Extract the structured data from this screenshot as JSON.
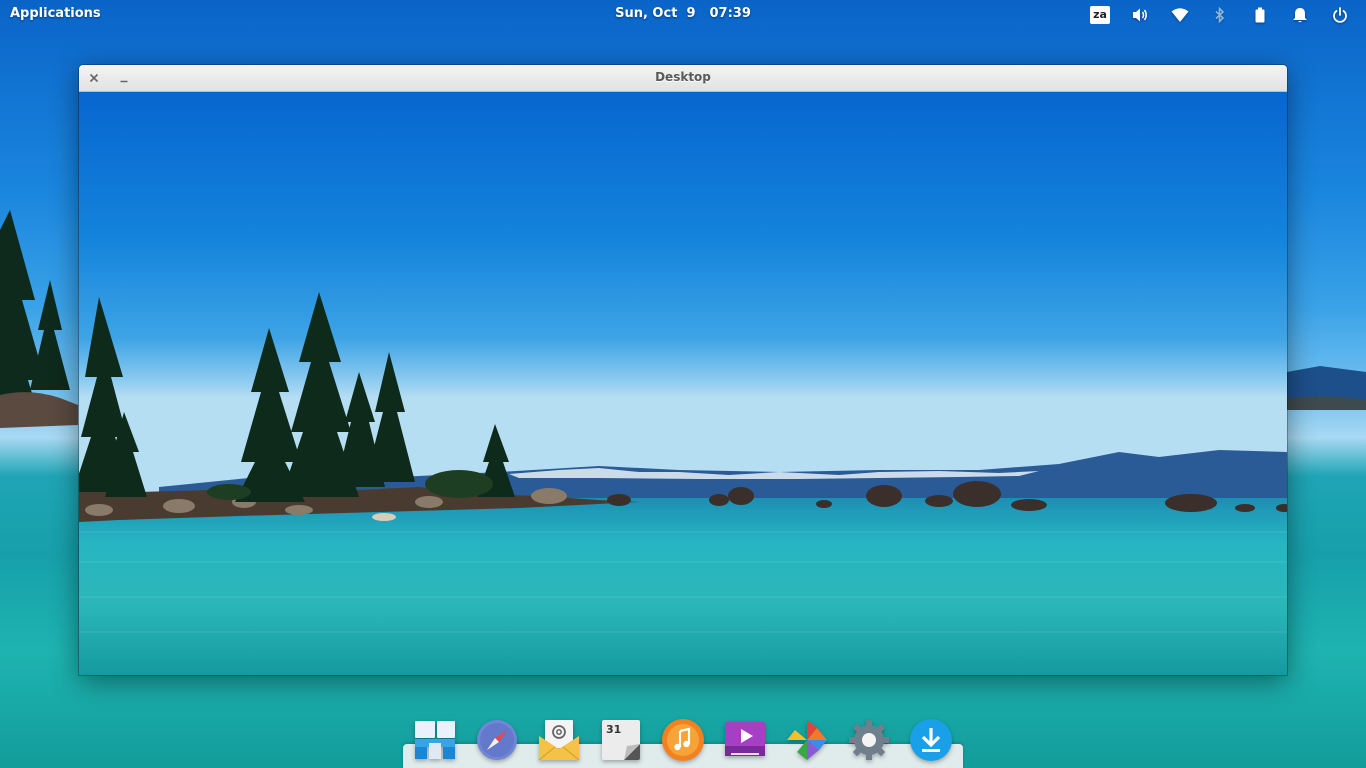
{
  "panel": {
    "applications_label": "Applications",
    "date": "Sun, Oct  9",
    "time": "07:39",
    "keyboard_layout": "za",
    "indicators": [
      "keyboard-layout-icon",
      "volume-icon",
      "wifi-icon",
      "bluetooth-icon",
      "battery-icon",
      "notifications-icon",
      "power-icon"
    ]
  },
  "window": {
    "title": "Desktop",
    "buttons": [
      "close-icon",
      "minimize-icon"
    ]
  },
  "dock": {
    "items": [
      "multitasking-view-icon",
      "web-browser-icon",
      "mail-icon",
      "calendar-icon",
      "music-icon",
      "videos-icon",
      "photos-icon",
      "settings-icon",
      "downloads-icon"
    ],
    "calendar_day": "31"
  },
  "colors": {
    "sky_top": "#0a64c8",
    "water": "#17a0ab",
    "titlebar": "#e8e8e8",
    "dock": "#f2f2f2"
  }
}
